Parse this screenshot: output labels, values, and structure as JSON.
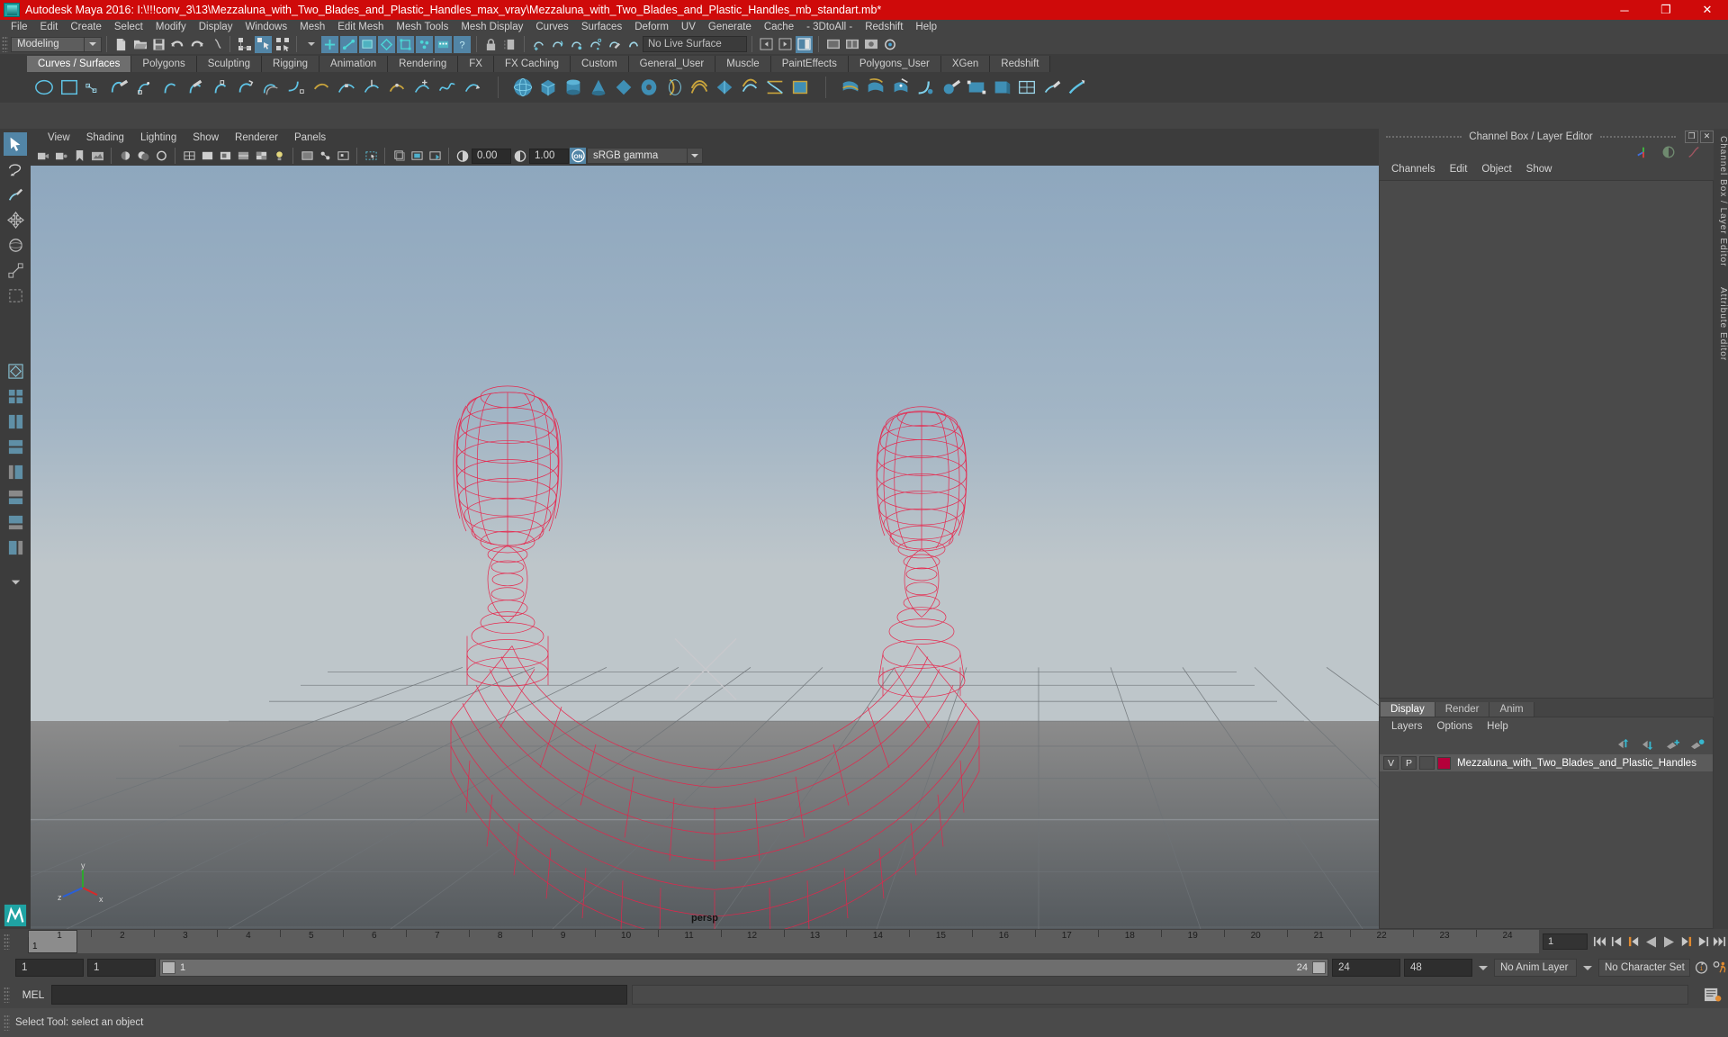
{
  "window": {
    "title": "Autodesk Maya 2016: I:\\!!!conv_3\\13\\Mezzaluna_with_Two_Blades_and_Plastic_Handles_max_vray\\Mezzaluna_with_Two_Blades_and_Plastic_Handles_mb_standart.mb*",
    "minimize": "─",
    "maximize": "❐",
    "close": "✕",
    "title_bg": "#cf0a0a"
  },
  "menubar": {
    "items": [
      "File",
      "Edit",
      "Create",
      "Select",
      "Modify",
      "Display",
      "Windows",
      "Mesh",
      "Edit Mesh",
      "Mesh Tools",
      "Mesh Display",
      "Curves",
      "Surfaces",
      "Deform",
      "UV",
      "Generate",
      "Cache",
      "- 3DtoAll -",
      "Redshift",
      "Help"
    ]
  },
  "statusline": {
    "mode": "Modeling",
    "live_surface": "No Live Surface"
  },
  "shelf": {
    "tabs": [
      {
        "label": "Curves / Surfaces",
        "active": true
      },
      {
        "label": "Polygons",
        "active": false
      },
      {
        "label": "Sculpting",
        "active": false
      },
      {
        "label": "Rigging",
        "active": false
      },
      {
        "label": "Animation",
        "active": false
      },
      {
        "label": "Rendering",
        "active": false
      },
      {
        "label": "FX",
        "active": false
      },
      {
        "label": "FX Caching",
        "active": false
      },
      {
        "label": "Custom",
        "active": false
      },
      {
        "label": "General_User",
        "active": false
      },
      {
        "label": "Muscle",
        "active": false
      },
      {
        "label": "PaintEffects",
        "active": false
      },
      {
        "label": "Polygons_User",
        "active": false
      },
      {
        "label": "XGen",
        "active": false
      },
      {
        "label": "Redshift",
        "active": false
      }
    ]
  },
  "viewport": {
    "menu": [
      "View",
      "Shading",
      "Lighting",
      "Show",
      "Renderer",
      "Panels"
    ],
    "exposure": "0.00",
    "gamma_value": "1.00",
    "color_management": "sRGB gamma",
    "cm_toggle": "ON",
    "camera_label": "persp",
    "axis_x": "x",
    "axis_y": "y",
    "axis_z": "z",
    "wire_color": "#e8234a"
  },
  "right_panel": {
    "title": "Channel Box / Layer Editor",
    "restore": "❐",
    "close": "✕",
    "menu": [
      "Channels",
      "Edit",
      "Object",
      "Show"
    ],
    "side_label": "Channel Box / Layer Editor",
    "side_label2": "Attribute Editor",
    "layer_tabs": [
      {
        "label": "Display",
        "active": true
      },
      {
        "label": "Render",
        "active": false
      },
      {
        "label": "Anim",
        "active": false
      }
    ],
    "layer_menu": [
      "Layers",
      "Options",
      "Help"
    ],
    "layers": [
      {
        "v": "V",
        "p": "P",
        "color": "#b5003a",
        "name": "Mezzaluna_with_Two_Blades_and_Plastic_Handles"
      }
    ]
  },
  "timeline": {
    "ticks": [
      "1",
      "2",
      "3",
      "4",
      "5",
      "6",
      "7",
      "8",
      "9",
      "10",
      "11",
      "12",
      "13",
      "14",
      "15",
      "16",
      "17",
      "18",
      "19",
      "20",
      "21",
      "22",
      "23",
      "24"
    ],
    "current_frame": "1",
    "current_field": "1",
    "playback_buttons": [
      "go-to-start",
      "step-back-key",
      "step-back-frame",
      "play-backwards",
      "play-forwards",
      "step-forward-frame",
      "step-forward-key",
      "go-to-end"
    ]
  },
  "range": {
    "anim_start": "1",
    "anim_end": "1",
    "range_start_label": "1",
    "range_end_label": "24",
    "playback_end": "24",
    "anim_total_end": "48",
    "anim_layer": "No Anim Layer",
    "character_set": "No Character Set"
  },
  "command": {
    "label": "MEL",
    "input_value": "",
    "result_value": ""
  },
  "help": {
    "text": "Select Tool: select an object"
  }
}
